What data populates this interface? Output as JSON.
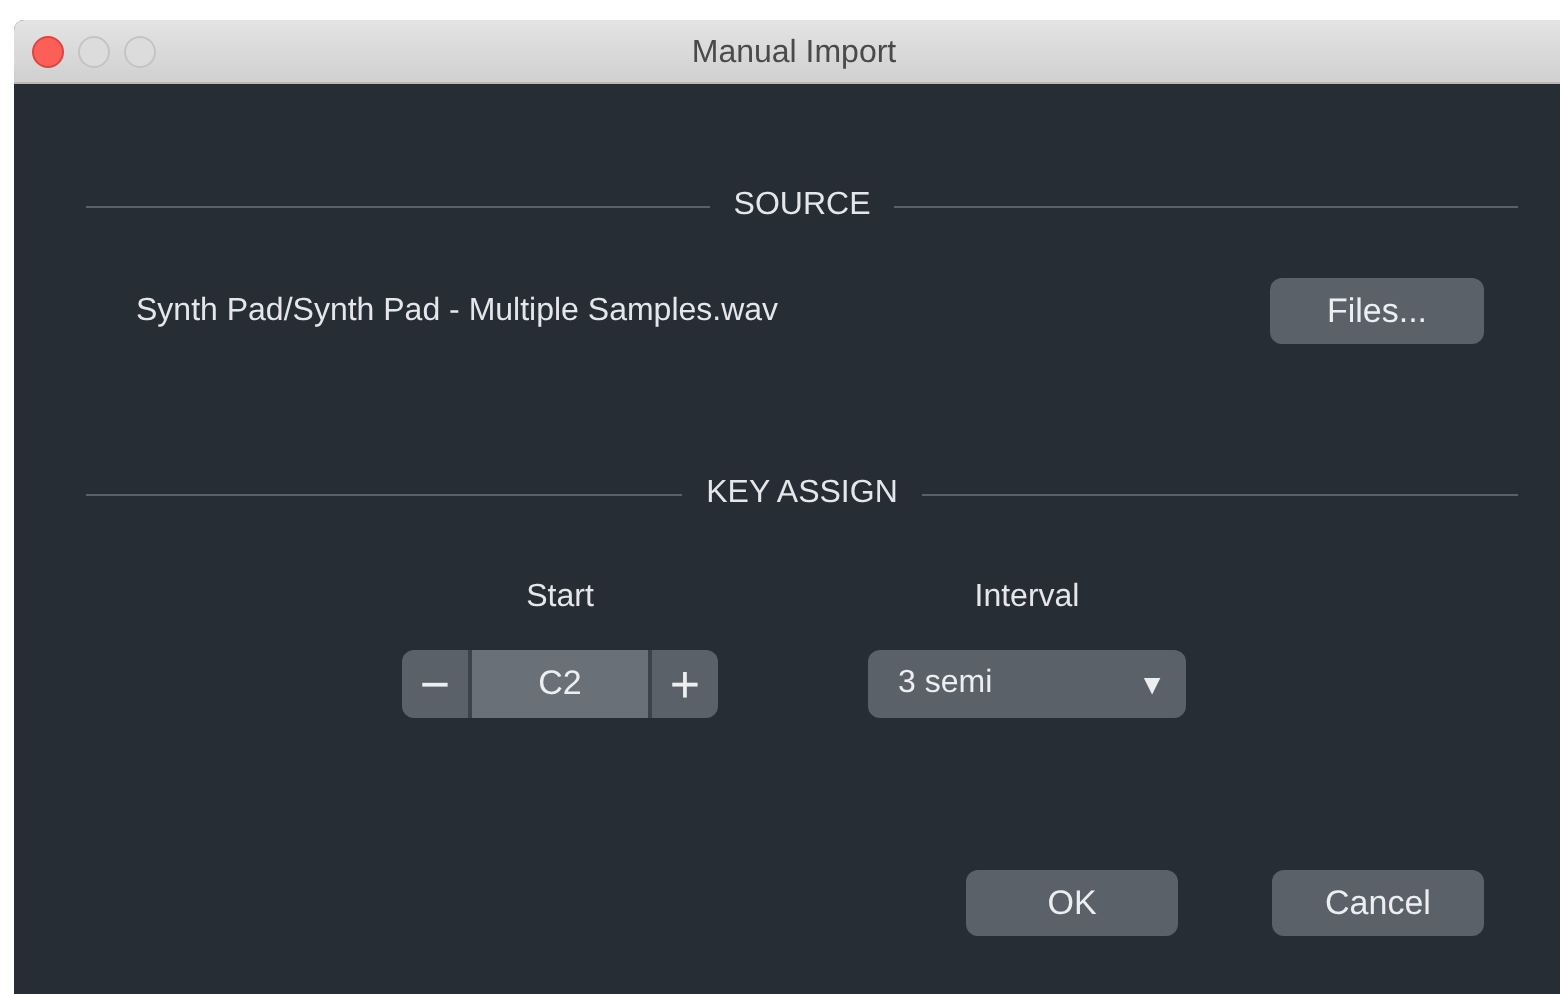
{
  "window": {
    "title": "Manual Import"
  },
  "source": {
    "heading": "SOURCE",
    "file": "Synth Pad/Synth Pad - Multiple Samples.wav",
    "button": "Files..."
  },
  "key_assign": {
    "heading": "KEY ASSIGN",
    "start": {
      "label": "Start",
      "decrement": "−",
      "value": "C2",
      "increment": "+"
    },
    "interval": {
      "label": "Interval",
      "value": "3 semi",
      "arrow": "▼"
    }
  },
  "buttons": [
    "OK",
    "Cancel"
  ]
}
